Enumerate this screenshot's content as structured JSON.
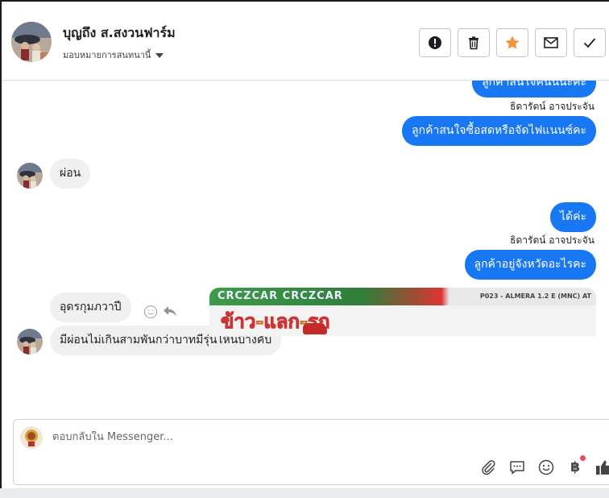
{
  "header": {
    "contact_name": "บุญถึง ส.สงวนฟาร์ม",
    "assign_label": "มอบหมายการสนทนานี้",
    "actions": [
      "report-icon",
      "trash-icon",
      "star-icon",
      "envelope-icon",
      "check-icon"
    ],
    "star_color": "#f7923a"
  },
  "messages": {
    "out1_partial": "ลูกค้าสนใจคันนี้นะคะ",
    "sender1": "ธิดารัตน์ อาจประจัน",
    "out2": "ลูกค้าสนใจซื้อสดหรือจัดไฟแนนซ์คะ",
    "in1": "ผ่อน",
    "out3": "ได้ค่ะ",
    "sender2": "ธิดารัตน์ อาจประจัน",
    "out4": "ลูกค้าอยู่จังหวัดอะไรคะ",
    "in2": "อุดรกุมภวาปี",
    "in3": "มีผ่อนไม่เกินสามพันกว่าบาทมีรุ่นไหนบ้างคับ"
  },
  "image_preview": {
    "banner_text": "CRCZCAR CRCZCAR",
    "model_code": "P023 - ALMERA 1.2 E (MNC) AT",
    "headline": "ข้าว-แลก-รถ"
  },
  "composer": {
    "placeholder": "ตอบกลับใน Messenger...",
    "tools": [
      "attach-icon",
      "saved-reply-icon",
      "emoji-icon",
      "baht-icon",
      "thumbs-up-icon"
    ],
    "baht_symbol": "฿"
  },
  "colors": {
    "outgoing_bubble": "#1877f2",
    "incoming_bubble": "#f0f0f0"
  }
}
